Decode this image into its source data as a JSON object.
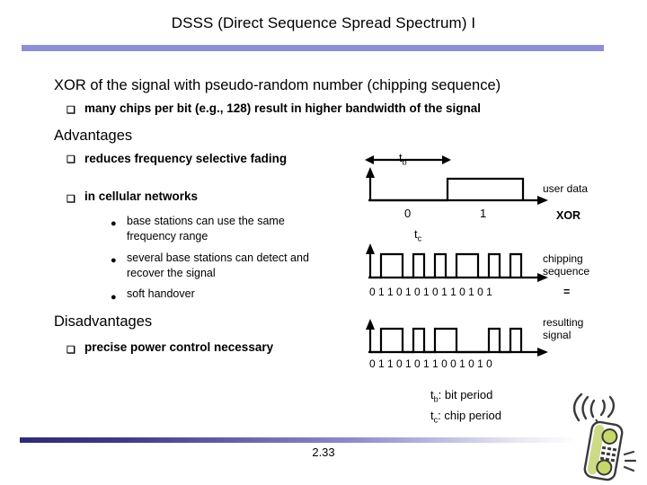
{
  "slide": {
    "title": "DSSS (Direct Sequence Spread Spectrum) I",
    "page_number": "2.33",
    "accent_color": "#8d8fd6",
    "footer_gradient_start": "#2d2b74"
  },
  "body": {
    "intro": "XOR of the signal with pseudo-random number (chipping sequence)",
    "intro_sub": "many chips per bit (e.g., 128) result in higher bandwidth of the signal",
    "advantages_heading": "Advantages",
    "advantages": [
      {
        "text": "reduces frequency selective fading",
        "bullet": "square-bullet"
      },
      {
        "text": "in cellular networks",
        "bullet": "square-bullet"
      }
    ],
    "cellular_details": [
      {
        "text": "base stations can use the same frequency range",
        "bullet": "round-bullet"
      },
      {
        "text": "several base stations can detect and recover the signal",
        "bullet": "round-bullet"
      },
      {
        "text": "soft handover",
        "bullet": "round-bullet"
      }
    ],
    "disadvantages_heading": "Disadvantages",
    "disadvantages": [
      {
        "text": "precise power control necessary",
        "bullet": "square-bullet"
      }
    ]
  },
  "diagram": {
    "tb_label": "t",
    "tb_sub": "b",
    "tc_label": "t",
    "tc_sub": "c",
    "user_data": {
      "name": "user data",
      "bit_labels": [
        "0",
        "1"
      ],
      "bits": [
        0,
        1
      ]
    },
    "operator_xor": "XOR",
    "chipping": {
      "name": "chipping\nsequence",
      "bits_text": "0 1 1 0 1 0 1 0 1 1 0 1 0 1",
      "bits": [
        0,
        1,
        1,
        0,
        1,
        0,
        1,
        0,
        1,
        1,
        0,
        1,
        0,
        1
      ]
    },
    "operator_equals": "=",
    "resulting": {
      "name": "resulting\nsignal",
      "bits_text": "0 1 1 0 1 0 1 1 0 0 1 0 1 0",
      "bits": [
        0,
        1,
        1,
        0,
        1,
        0,
        1,
        1,
        0,
        0,
        1,
        0,
        1,
        0
      ]
    }
  },
  "legend": {
    "line1_sym": "t",
    "line1_sub": "b",
    "line1_text": ": bit period",
    "line2_sym": "t",
    "line2_sub": "c",
    "line2_text": ": chip period"
  }
}
